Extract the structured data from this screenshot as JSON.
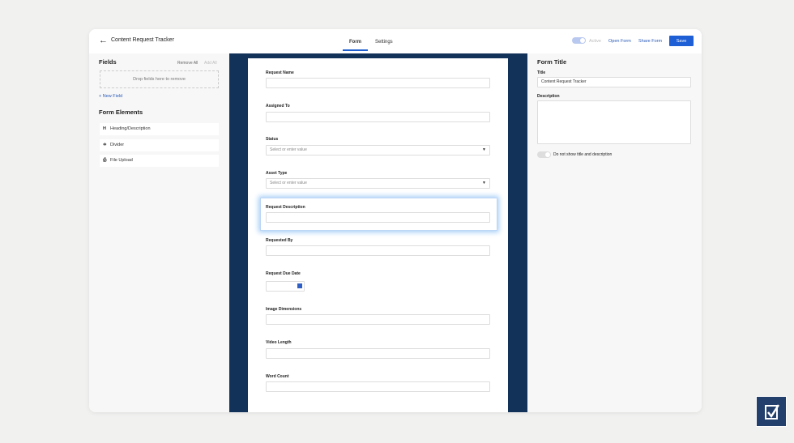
{
  "header": {
    "back_icon": "arrow-left",
    "title": "Content Request Tracker",
    "tabs": [
      "Form",
      "Settings"
    ],
    "active_label": "Active",
    "open_form": "Open Form",
    "share_form": "Share Form",
    "save": "Save"
  },
  "left": {
    "fields_heading": "Fields",
    "remove_all": "Remove All",
    "add_all": "Add All",
    "drop_zone": "Drop fields here to remove",
    "new_field": "+ New Field",
    "form_elements_heading": "Form Elements",
    "elements": [
      {
        "icon": "H",
        "label": "Heading/Description"
      },
      {
        "icon": "≑",
        "label": "Divider"
      },
      {
        "icon": "⎙",
        "label": "File Upload"
      }
    ]
  },
  "form": {
    "fields": [
      {
        "label": "Request Name",
        "type": "text",
        "value": ""
      },
      {
        "label": "Assigned To",
        "type": "text",
        "value": ""
      },
      {
        "label": "Status",
        "type": "select",
        "placeholder": "Select or enter value"
      },
      {
        "label": "Asset Type",
        "type": "select",
        "placeholder": "Select or enter value"
      },
      {
        "label": "Request Description",
        "type": "text",
        "value": ""
      },
      {
        "label": "Requested By",
        "type": "text",
        "value": ""
      },
      {
        "label": "Request Due Date",
        "type": "date",
        "value": ""
      },
      {
        "label": "Image Dimensions",
        "type": "text",
        "value": ""
      },
      {
        "label": "Video Length",
        "type": "text",
        "value": ""
      },
      {
        "label": "Word Count",
        "type": "text",
        "value": ""
      }
    ]
  },
  "right": {
    "heading": "Form Title",
    "title_label": "Title",
    "title_value": "Content Request Tracker",
    "description_label": "Description",
    "description_value": "",
    "hide_toggle_label": "Do not show title and description"
  },
  "colors": {
    "accent": "#1f5fd6",
    "canvas": "#133259"
  }
}
